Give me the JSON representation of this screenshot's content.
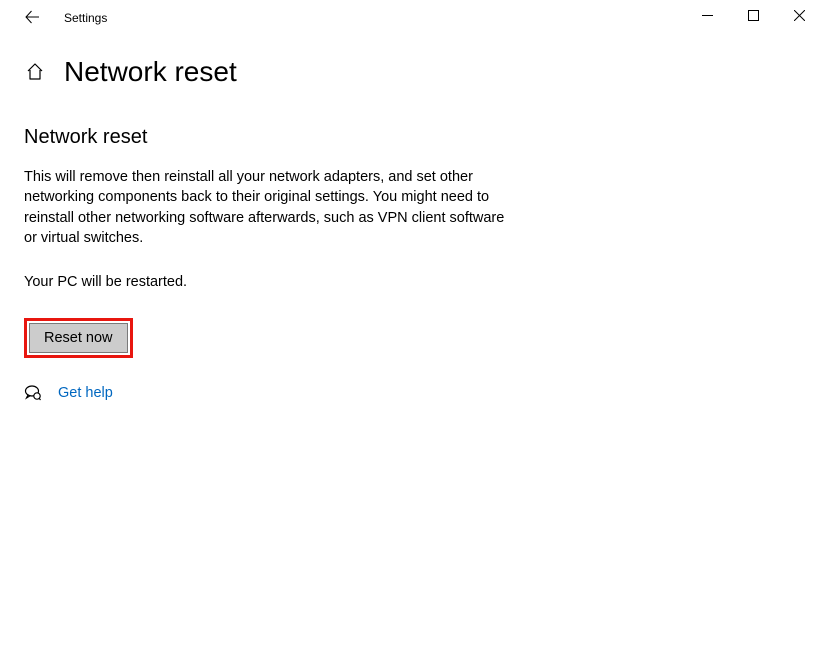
{
  "titlebar": {
    "app_name": "Settings"
  },
  "header": {
    "title": "Network reset"
  },
  "main": {
    "heading": "Network reset",
    "description": "This will remove then reinstall all your network adapters, and set other networking components back to their original settings. You might need to reinstall other networking software afterwards, such as VPN client software or virtual switches.",
    "restart_note": "Your PC will be restarted.",
    "reset_button_label": "Reset now",
    "help_link_label": "Get help"
  }
}
